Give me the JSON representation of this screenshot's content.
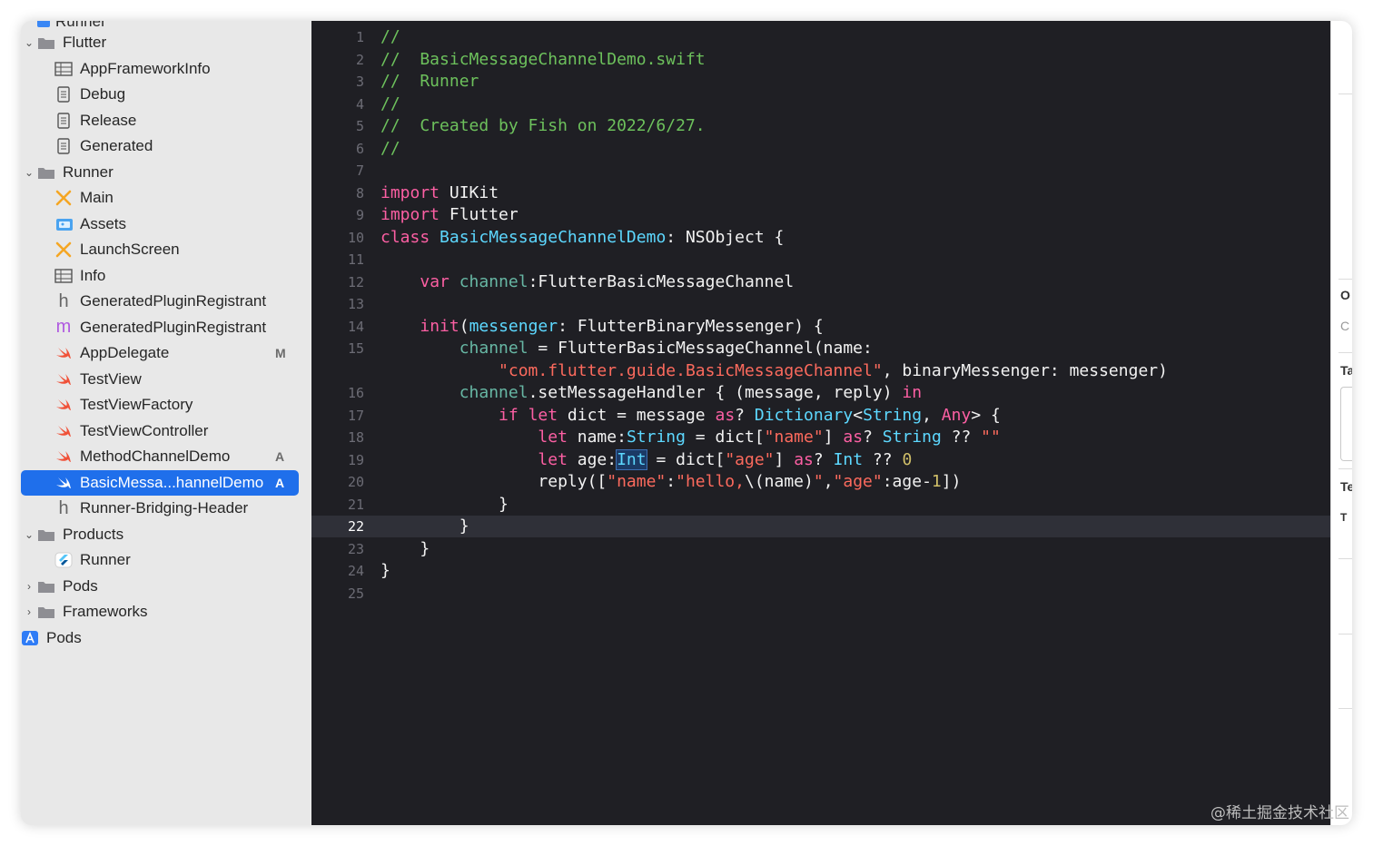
{
  "navigator": {
    "clipped_item": "Runner",
    "items": [
      {
        "label": "Flutter",
        "badge": ""
      },
      {
        "label": "AppFrameworkInfo",
        "badge": ""
      },
      {
        "label": "Debug",
        "badge": ""
      },
      {
        "label": "Release",
        "badge": ""
      },
      {
        "label": "Generated",
        "badge": ""
      },
      {
        "label": "Runner",
        "badge": ""
      },
      {
        "label": "Main",
        "badge": ""
      },
      {
        "label": "Assets",
        "badge": ""
      },
      {
        "label": "LaunchScreen",
        "badge": ""
      },
      {
        "label": "Info",
        "badge": ""
      },
      {
        "label": "GeneratedPluginRegistrant",
        "badge": ""
      },
      {
        "label": "GeneratedPluginRegistrant",
        "badge": ""
      },
      {
        "label": "AppDelegate",
        "badge": "M"
      },
      {
        "label": "TestView",
        "badge": ""
      },
      {
        "label": "TestViewFactory",
        "badge": ""
      },
      {
        "label": "TestViewController",
        "badge": ""
      },
      {
        "label": "MethodChannelDemo",
        "badge": "A"
      },
      {
        "label": "BasicMessa...hannelDemo",
        "badge": "A"
      },
      {
        "label": "Runner-Bridging-Header",
        "badge": ""
      },
      {
        "label": "Products",
        "badge": ""
      },
      {
        "label": "Runner",
        "badge": ""
      },
      {
        "label": "Pods",
        "badge": ""
      },
      {
        "label": "Frameworks",
        "badge": ""
      },
      {
        "label": "Pods",
        "badge": ""
      }
    ]
  },
  "editor": {
    "current_line": "22",
    "lines": [
      {
        "n": "1",
        "code": "//"
      },
      {
        "n": "2",
        "code": "//  BasicMessageChannelDemo.swift"
      },
      {
        "n": "3",
        "code": "//  Runner"
      },
      {
        "n": "4",
        "code": "//"
      },
      {
        "n": "5",
        "code": "//  Created by Fish on 2022/6/27."
      },
      {
        "n": "6",
        "code": "//"
      },
      {
        "n": "7",
        "code": ""
      },
      {
        "n": "8",
        "code": "import UIKit"
      },
      {
        "n": "9",
        "code": "import Flutter"
      },
      {
        "n": "10",
        "code": "class BasicMessageChannelDemo: NSObject {"
      },
      {
        "n": "11",
        "code": ""
      },
      {
        "n": "12",
        "code": "    var channel:FlutterBasicMessageChannel"
      },
      {
        "n": "13",
        "code": ""
      },
      {
        "n": "14",
        "code": "    init(messenger: FlutterBinaryMessenger) {"
      },
      {
        "n": "15",
        "code": "        channel = FlutterBasicMessageChannel(name:"
      },
      {
        "n": "",
        "code": "            \"com.flutter.guide.BasicMessageChannel\", binaryMessenger: messenger)"
      },
      {
        "n": "16",
        "code": "        channel.setMessageHandler { (message, reply) in"
      },
      {
        "n": "17",
        "code": "            if let dict = message as? Dictionary<String, Any> {"
      },
      {
        "n": "18",
        "code": "                let name:String = dict[\"name\"] as? String ?? \"\""
      },
      {
        "n": "19",
        "code": "                let age:Int = dict[\"age\"] as? Int ?? 0"
      },
      {
        "n": "20",
        "code": "                reply([\"name\":\"hello,\\(name)\",\"age\":age-1])"
      },
      {
        "n": "21",
        "code": "            }"
      },
      {
        "n": "22",
        "code": "        }"
      },
      {
        "n": "23",
        "code": "    }"
      },
      {
        "n": "24",
        "code": "}"
      },
      {
        "n": "25",
        "code": ""
      }
    ]
  },
  "inspector": {
    "labels": [
      "O",
      "C",
      "Ta",
      "Te",
      "T"
    ]
  },
  "watermark": "@稀土掘金技术社区",
  "colors": {
    "selection": "#1f6feb",
    "editor_bg": "#1f1f24",
    "comment": "#6dc15c",
    "keyword": "#fc5fa3",
    "string": "#fc6a5d",
    "type": "#5dd8ff",
    "property": "#67b7a4",
    "number": "#d0bf69"
  }
}
